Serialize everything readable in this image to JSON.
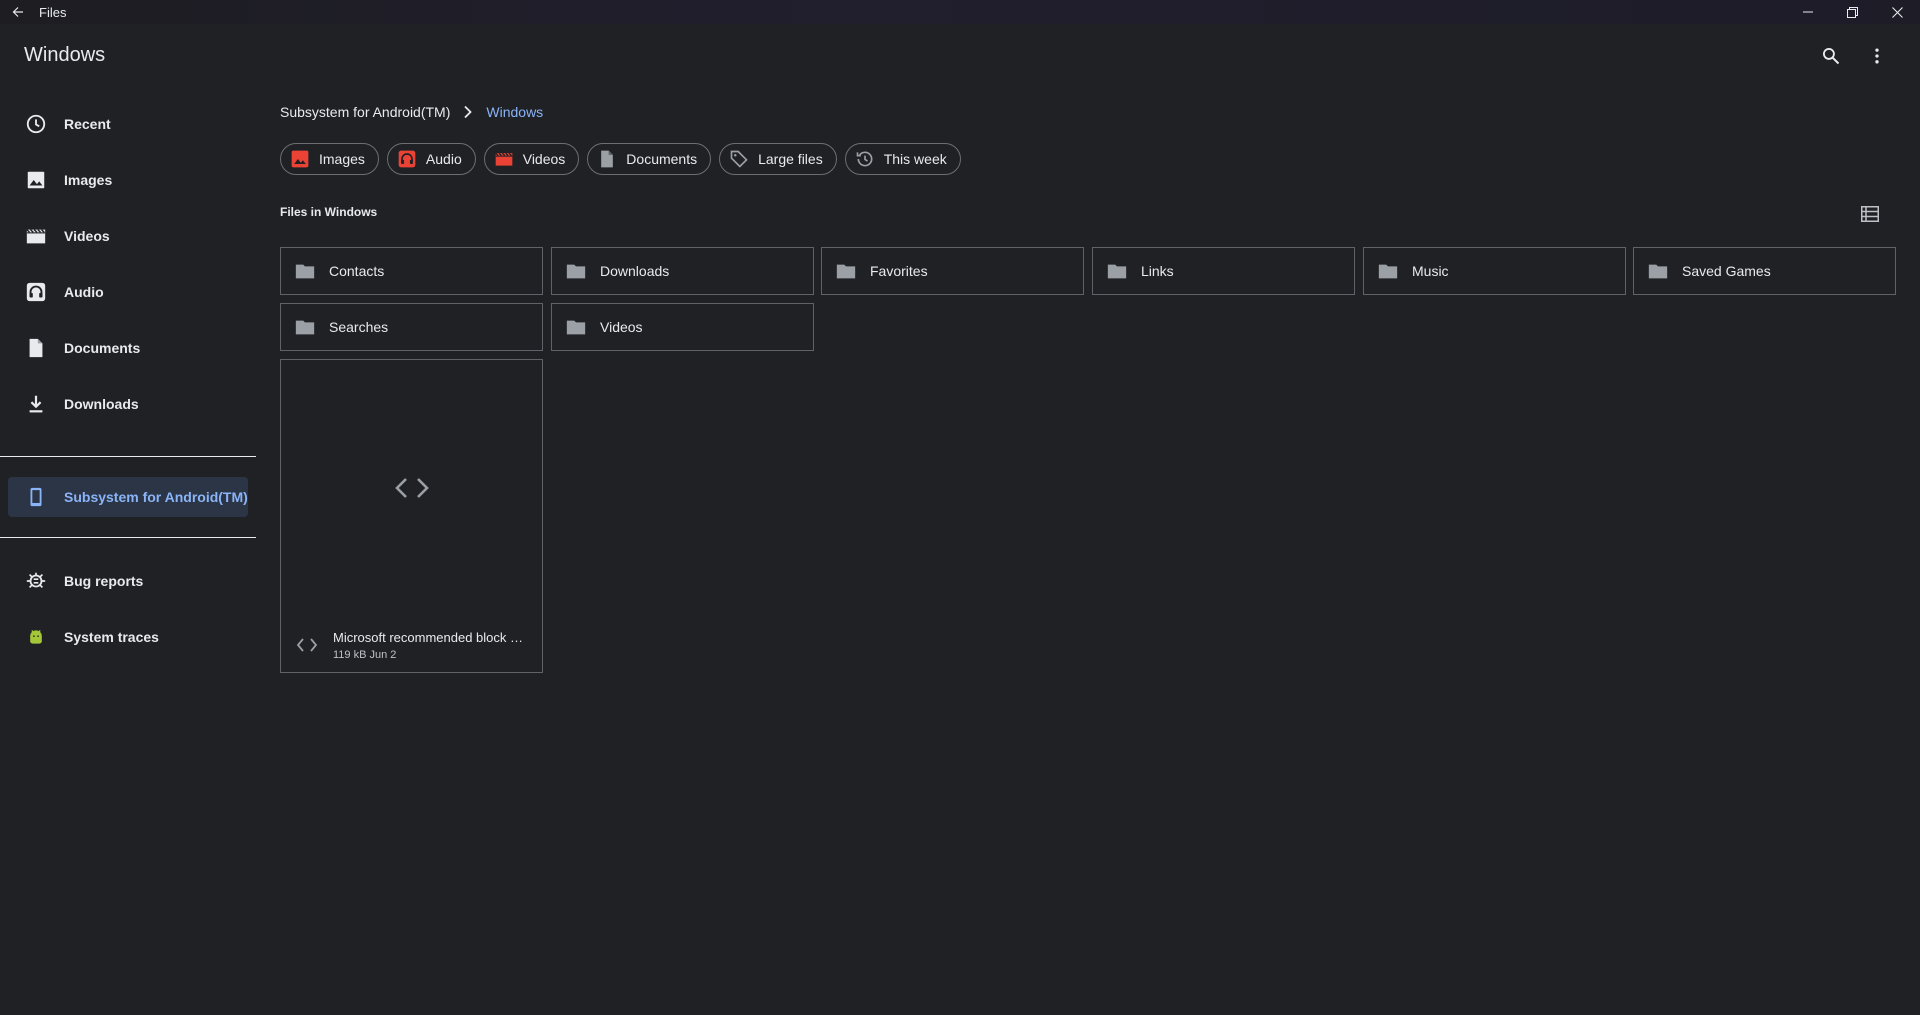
{
  "window": {
    "title": "Files"
  },
  "appbar": {
    "title": "Windows",
    "icons": [
      "search-icon",
      "more-vert-icon"
    ]
  },
  "sidebar": {
    "items": [
      {
        "label": "Recent",
        "icon": "clock-icon"
      },
      {
        "label": "Images",
        "icon": "image-icon"
      },
      {
        "label": "Videos",
        "icon": "movie-icon"
      },
      {
        "label": "Audio",
        "icon": "headphones-icon"
      },
      {
        "label": "Documents",
        "icon": "document-icon"
      },
      {
        "label": "Downloads",
        "icon": "download-icon"
      }
    ],
    "selected": {
      "label": "Subsystem for Android(TM)",
      "icon": "phone-icon"
    },
    "extras": [
      {
        "label": "Bug reports",
        "icon": "bug-icon"
      },
      {
        "label": "System traces",
        "icon": "android-icon"
      }
    ]
  },
  "breadcrumb": {
    "root": "Subsystem for Android(TM)",
    "current": "Windows"
  },
  "chips": [
    {
      "label": "Images",
      "icon": "image-icon"
    },
    {
      "label": "Audio",
      "icon": "headphones-icon"
    },
    {
      "label": "Videos",
      "icon": "movie-icon"
    },
    {
      "label": "Documents",
      "icon": "document-icon"
    },
    {
      "label": "Large files",
      "icon": "tag-icon"
    },
    {
      "label": "This week",
      "icon": "history-icon"
    }
  ],
  "section": {
    "label": "Files in Windows"
  },
  "folders": [
    "Contacts",
    "Downloads",
    "Favorites",
    "Links",
    "Music",
    "Saved Games",
    "Searches",
    "Videos"
  ],
  "files": [
    {
      "name": "Microsoft recommended block …",
      "meta": "119 kB Jun 2",
      "icon": "code-icon"
    }
  ],
  "colors": {
    "background": "#202124",
    "accent": "#8ab4f8",
    "chip_icon_red": "#ea4335",
    "selected_bg": "#2c3545",
    "android_green": "#a4c639"
  }
}
